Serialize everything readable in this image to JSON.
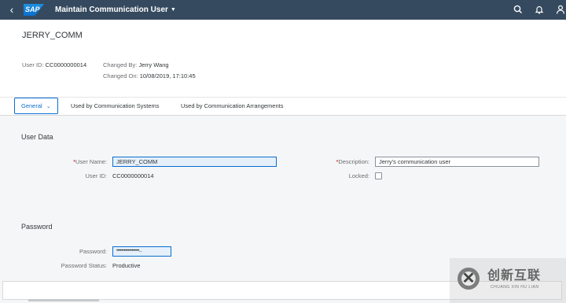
{
  "shell": {
    "logo": "SAP",
    "app_title": "Maintain Communication User",
    "icons": [
      "back-icon",
      "search-icon",
      "bell-icon",
      "user-icon"
    ]
  },
  "header": {
    "title": "JERRY_COMM",
    "user_id_label": "User ID:",
    "user_id_value": "CC0000000014",
    "changed_by_label": "Changed By:",
    "changed_by_value": "Jerry Wang",
    "changed_on_label": "Changed On:",
    "changed_on_value": "10/08/2019, 17:10:45"
  },
  "tabs": [
    {
      "label": "General",
      "selected": true
    },
    {
      "label": "Used by Communication Systems",
      "selected": false
    },
    {
      "label": "Used by Communication Arrangements",
      "selected": false
    }
  ],
  "user_data": {
    "section_title": "User Data",
    "required_marker": "*",
    "user_name_label": "User Name:",
    "user_name_value": "JERRY_COMM",
    "description_label": "Description:",
    "description_value": "Jerry's communication user",
    "user_id_label": "User ID:",
    "user_id_value": "CC0000000014",
    "locked_label": "Locked:",
    "locked": false
  },
  "password": {
    "section_title": "Password",
    "password_label": "Password:",
    "password_value": "••••••••••••••••••...",
    "status_label": "Password Status:",
    "status_value": "Productive"
  },
  "watermark": {
    "text_cn": "创新互联",
    "text_en": "CHUANG XIN HU LIAN"
  },
  "colors": {
    "shell": "#354a5f",
    "accent": "#0a6ed1",
    "required": "#bb0000",
    "background": "#f5f6f7"
  }
}
